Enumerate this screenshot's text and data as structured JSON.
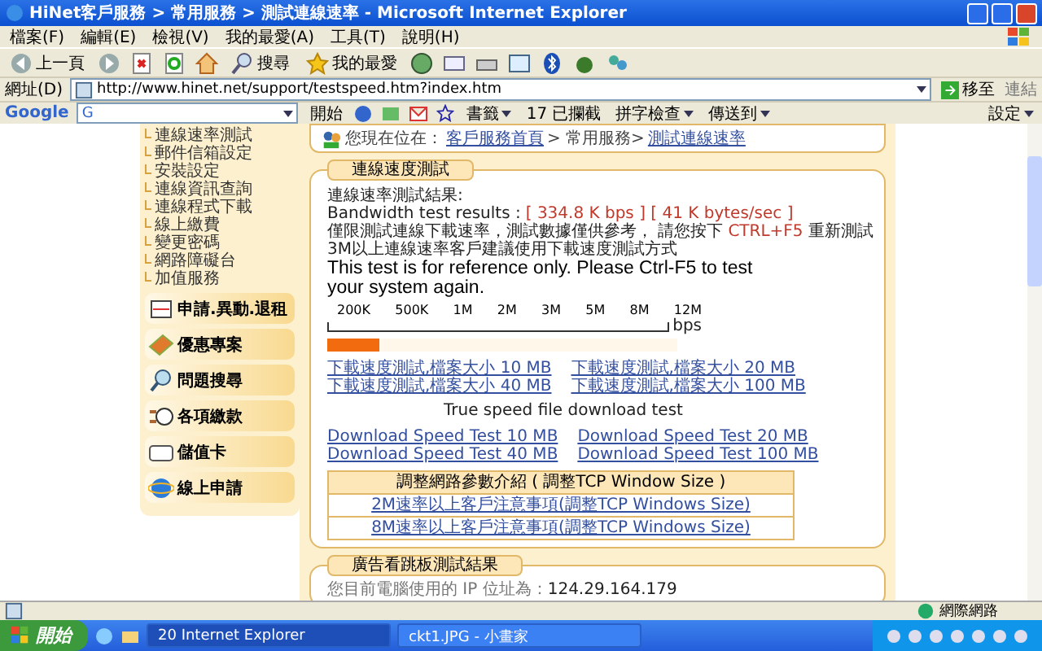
{
  "window": {
    "title": "HiNet客戶服務 > 常用服務 > 測試連線速率 - Microsoft Internet Explorer"
  },
  "menu": [
    "檔案(F)",
    "編輯(E)",
    "檢視(V)",
    "我的最愛(A)",
    "工具(T)",
    "說明(H)"
  ],
  "toolbar": {
    "back": "上一頁",
    "search": "搜尋",
    "favorites": "我的最愛"
  },
  "address": {
    "label": "網址(D)",
    "value": "http://www.hinet.net/support/testspeed.htm?index.htm",
    "go": "移至",
    "links": "連結"
  },
  "google_bar": {
    "logo": "Google",
    "search": "G",
    "start": "開始",
    "bookmarks": "書籤",
    "blocked": "17 已攔截",
    "spell": "拼字檢查",
    "send": "傳送到",
    "settings": "設定"
  },
  "sidebar": {
    "items": [
      "連線速率測試",
      "郵件信箱設定",
      "安裝設定",
      "連線資訊查詢",
      "連線程式下載",
      "線上繳費",
      "變更密碼",
      "網路障礙台",
      "加值服務"
    ],
    "buttons": [
      {
        "kind": "form",
        "label": "申請.異動.退租"
      },
      {
        "kind": "book",
        "label": "優惠專案"
      },
      {
        "kind": "search",
        "label": "問題搜尋"
      },
      {
        "kind": "pay",
        "label": "各項繳款"
      },
      {
        "kind": "card",
        "label": "儲值卡"
      },
      {
        "kind": "ie",
        "label": "線上申請"
      }
    ]
  },
  "breadcrumb": {
    "prefix": "您現在位在：",
    "items": [
      {
        "text": "客戶服務首頁",
        "kind": "link"
      },
      {
        "text": "> 常用服務>",
        "kind": "text"
      },
      {
        "text": "測試連線速率",
        "kind": "link"
      }
    ]
  },
  "speed_test": {
    "title": "連線速度測試",
    "result_label": "連線速率測試結果:",
    "bandwidth_label": "Bandwidth test results :",
    "bandwidth_value": "[ 334.8 K bps ] [ 41 K bytes/sec ]",
    "note_before": "僅限測試連線下載速率，測試數據僅供參考， 請您按下",
    "note_key": "CTRL+F5",
    "note_after": "重新測試",
    "note_3m": "3M以上連線速率客戶建議使用下載速度測試方式",
    "reference": "This test is for reference only. Please Ctrl-F5 to test your system again.",
    "scale": [
      "200K",
      "500K",
      "1M",
      "2M",
      "3M",
      "5M",
      "8M",
      "12M"
    ],
    "unit": "bps",
    "level": 0.15,
    "download_links_zh": [
      "下載速度測試,檔案大小 10 MB",
      "下載速度測試,檔案大小 20 MB",
      "下載速度測試,檔案大小 40 MB",
      "下載速度測試,檔案大小 100 MB"
    ],
    "true_speed_title": "True speed file download test",
    "download_links_en": [
      "Download Speed Test 10 MB",
      "Download Speed Test 20 MB",
      "Download Speed Test 40 MB",
      "Download Speed Test 100 MB"
    ],
    "tcp_table": {
      "header": "調整網路參數介紹 ( 調整TCP Window Size )",
      "links": [
        "2M速率以上客戶注意事項(調整TCP Windows Size)",
        "8M速率以上客戶注意事項(調整TCP Windows Size)"
      ]
    }
  },
  "ad_test": {
    "title": "廣告看跳板測試結果",
    "ip_label": "您目前電腦使用的 IP 位址為：",
    "ip": "124.29.164.179"
  },
  "status_bar": {
    "zone": "網際網路"
  },
  "taskbar": {
    "start": "開始",
    "tasks": [
      {
        "label": "20 Internet Explorer",
        "selected": true
      },
      {
        "label": "ckt1.JPG - 小畫家",
        "selected": false
      }
    ]
  }
}
